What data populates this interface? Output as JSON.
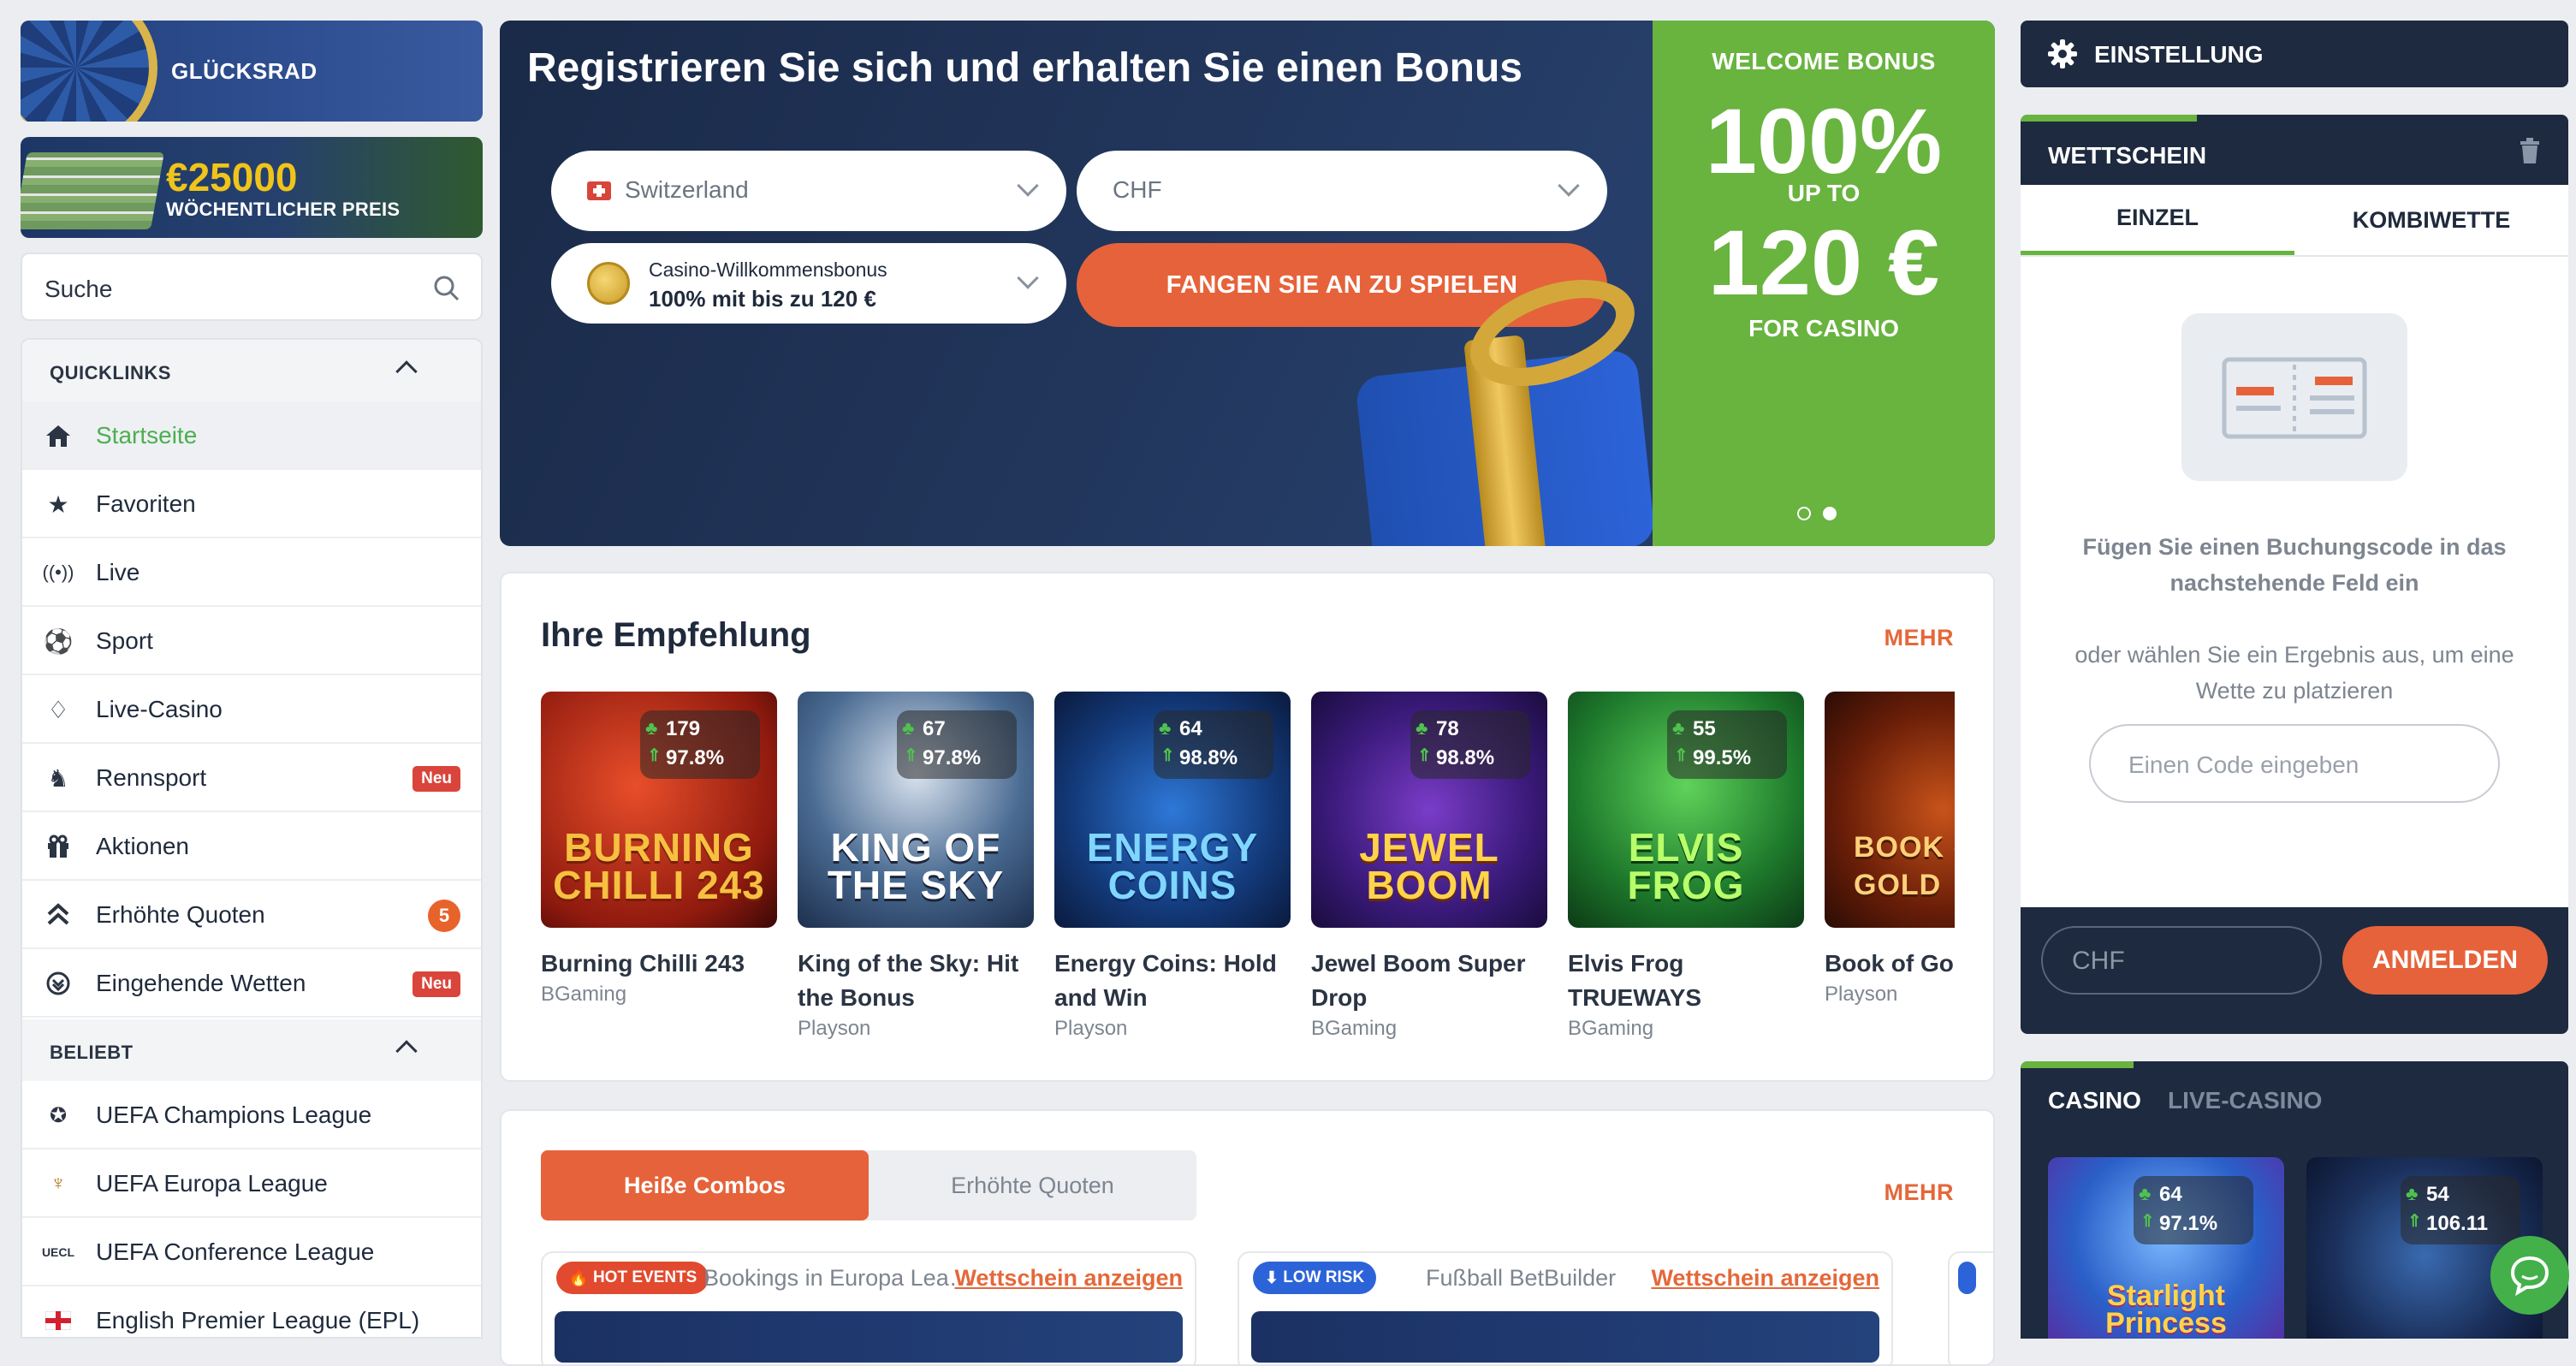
{
  "promos": {
    "wheel_label": "GLÜCKSRAD",
    "prize_amount": "€25000",
    "prize_label": "WÖCHENTLICHER PREIS"
  },
  "search": {
    "placeholder": "Suche"
  },
  "sidebar": {
    "quicklinks_title": "QUICKLINKS",
    "quicklinks": [
      {
        "label": "Startseite",
        "icon": "home-icon"
      },
      {
        "label": "Favoriten",
        "icon": "star-icon"
      },
      {
        "label": "Live",
        "icon": "broadcast-icon"
      },
      {
        "label": "Sport",
        "icon": "soccer-ball-icon"
      },
      {
        "label": "Live-Casino",
        "icon": "casino-chip-icon"
      },
      {
        "label": "Rennsport",
        "icon": "horse-icon",
        "badge": "Neu"
      },
      {
        "label": "Aktionen",
        "icon": "gift-icon"
      },
      {
        "label": "Erhöhte Quoten",
        "icon": "double-chevron-up-icon",
        "badge": "5"
      },
      {
        "label": "Eingehende Wetten",
        "icon": "incoming-bets-icon",
        "badge": "Neu"
      }
    ],
    "popular_title": "BELIEBT",
    "popular": [
      {
        "label": "UEFA Champions League",
        "icon": "champions-league-icon"
      },
      {
        "label": "UEFA Europa League",
        "icon": "europa-league-icon"
      },
      {
        "label": "UEFA Conference League",
        "icon": "conference-league-icon"
      },
      {
        "label": "English Premier League (EPL)",
        "icon": "england-flag-icon"
      }
    ]
  },
  "hero": {
    "title": "Registrieren Sie sich und erhalten Sie einen Bonus",
    "country": "Switzerland",
    "currency": "CHF",
    "bonus_label": "Casino-Willkommensbonus",
    "bonus_value": "100% mit bis zu 120 €",
    "play_button": "FANGEN SIE AN ZU SPIELEN",
    "welcome": "WELCOME BONUS",
    "percent": "100%",
    "up_to": "UP TO",
    "amount": "120 €",
    "for": "FOR CASINO"
  },
  "recommendations": {
    "title": "Ihre Empfehlung",
    "more": "MEHR",
    "games": [
      {
        "name": "Burning Chilli 243",
        "provider": "BGaming",
        "players": "179",
        "rtp": "97.8%",
        "art": "BURNING CHILLI 243"
      },
      {
        "name": "King of the Sky: Hit the Bonus",
        "provider": "Playson",
        "players": "67",
        "rtp": "97.8%",
        "art": "KING OF THE SKY"
      },
      {
        "name": "Energy Coins: Hold and Win",
        "provider": "Playson",
        "players": "64",
        "rtp": "98.8%",
        "art": "ENERGY COINS"
      },
      {
        "name": "Jewel Boom Super Drop",
        "provider": "BGaming",
        "players": "78",
        "rtp": "98.8%",
        "art": "JEWEL BOOM"
      },
      {
        "name": "Elvis Frog TRUEWAYS",
        "provider": "BGaming",
        "players": "55",
        "rtp": "99.5%",
        "art": "ELVIS FROG"
      },
      {
        "name": "Book of Gold Multichance",
        "provider": "Playson",
        "players": "",
        "rtp": "",
        "art": "BOOK of GOLD"
      }
    ]
  },
  "combos": {
    "tab_hot": "Heiße Combos",
    "tab_boost": "Erhöhte Quoten",
    "more": "MEHR",
    "events": [
      {
        "tag": "HOT EVENTS",
        "title": "Bookings in Europa Lea…",
        "link": "Wettschein anzeigen"
      },
      {
        "tag": "LOW RISK",
        "title": "Fußball BetBuilder",
        "link": "Wettschein anzeigen"
      }
    ]
  },
  "right": {
    "settings": "EINSTELLUNG",
    "betslip_title": "WETTSCHEIN",
    "tab_single": "EINZEL",
    "tab_combo": "KOMBIWETTE",
    "msg1": "Fügen Sie einen Buchungscode in das nachstehende Feld ein",
    "msg2": "oder wählen Sie ein Ergebnis aus, um eine Wette zu platzieren",
    "code_placeholder": "Einen Code eingeben",
    "currency_placeholder": "CHF",
    "login": "ANMELDEN",
    "casino_tab": "CASINO",
    "live_casino_tab": "LIVE-CASINO",
    "mini_games": [
      {
        "name": "Starlight Princess",
        "players": "64",
        "rtp": "97.1%"
      },
      {
        "name": "",
        "players": "54",
        "rtp": "106.11"
      }
    ]
  }
}
